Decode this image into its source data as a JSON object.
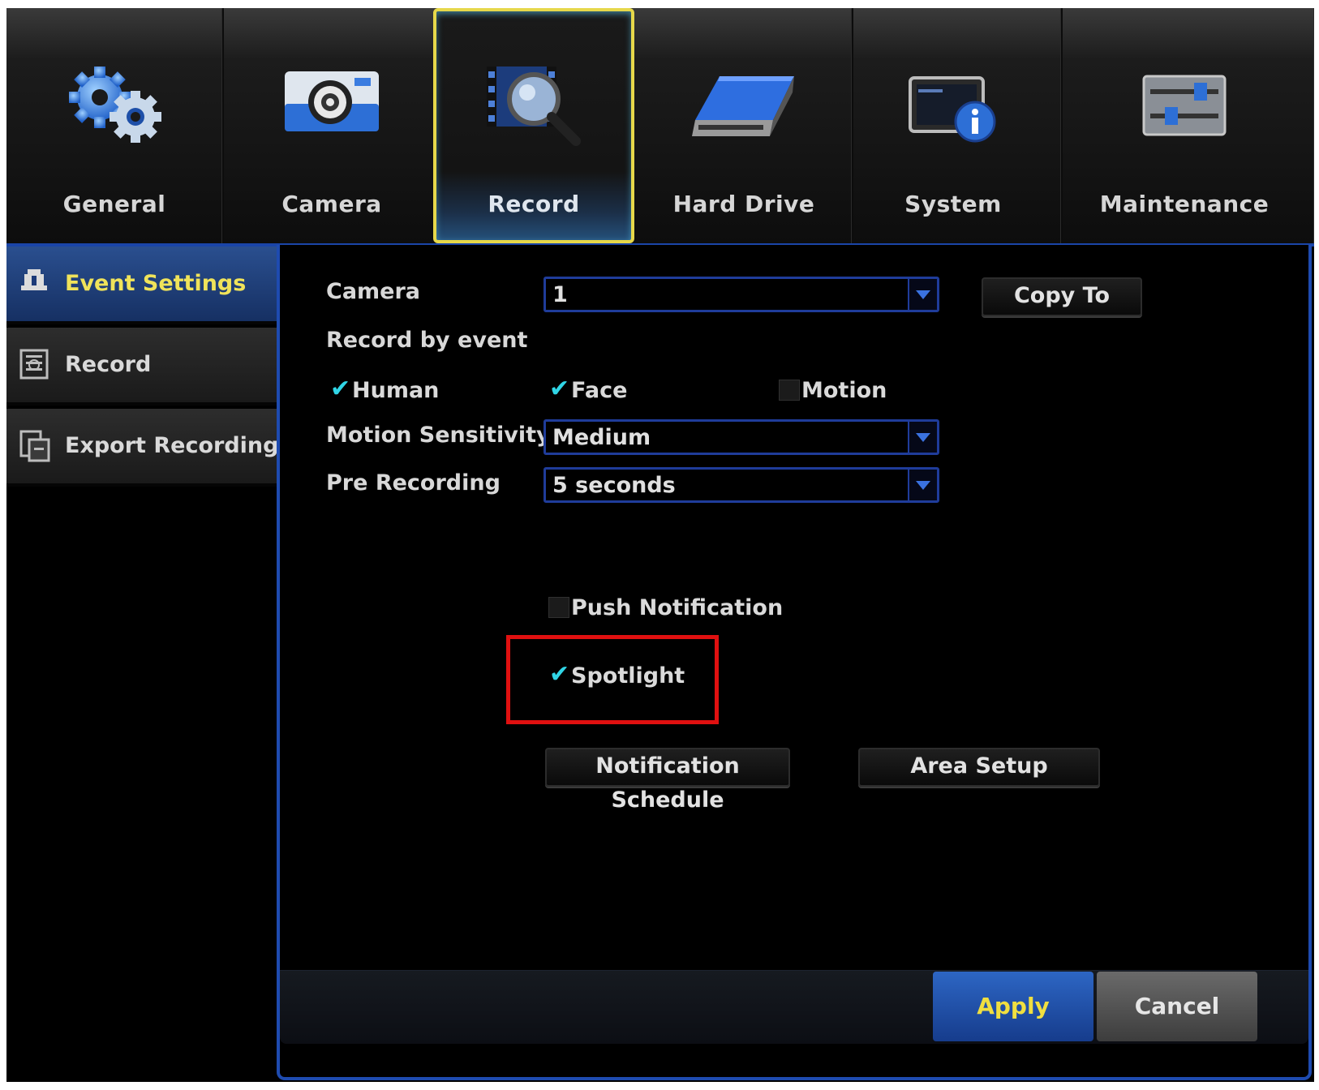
{
  "tabs": [
    {
      "label": "General",
      "icon": "gears-icon"
    },
    {
      "label": "Camera",
      "icon": "camera-icon"
    },
    {
      "label": "Record",
      "icon": "record-search-icon",
      "active": true
    },
    {
      "label": "Hard Drive",
      "icon": "hard-drive-icon"
    },
    {
      "label": "System",
      "icon": "system-info-icon"
    },
    {
      "label": "Maintenance",
      "icon": "sliders-icon"
    }
  ],
  "sidebar": {
    "items": [
      {
        "label": "Event Settings",
        "icon": "event-icon",
        "active": true
      },
      {
        "label": "Record",
        "icon": "record-list-icon"
      },
      {
        "label": "Export Recordings",
        "icon": "export-icon"
      }
    ]
  },
  "form": {
    "camera_label": "Camera",
    "camera_value": "1",
    "copy_to_label": "Copy To",
    "record_by_event_label": "Record by event",
    "human": {
      "label": "Human",
      "checked": true
    },
    "face": {
      "label": "Face",
      "checked": true
    },
    "motion": {
      "label": "Motion",
      "checked": false
    },
    "motion_sensitivity_label": "Motion Sensitivity",
    "motion_sensitivity_value": "Medium",
    "pre_recording_label": "Pre Recording",
    "pre_recording_value": "5 seconds",
    "push_notification": {
      "label": "Push Notification",
      "checked": false
    },
    "spotlight": {
      "label": "Spotlight",
      "checked": true
    },
    "notification_schedule_label": "Notification Schedule",
    "area_setup_label": "Area Setup"
  },
  "footer": {
    "apply_label": "Apply",
    "cancel_label": "Cancel"
  },
  "colors": {
    "accent_blue": "#1e4bb0",
    "active_text_yellow": "#f0e35a",
    "check_cyan": "#30d5e6",
    "highlight_red": "#e01010"
  }
}
